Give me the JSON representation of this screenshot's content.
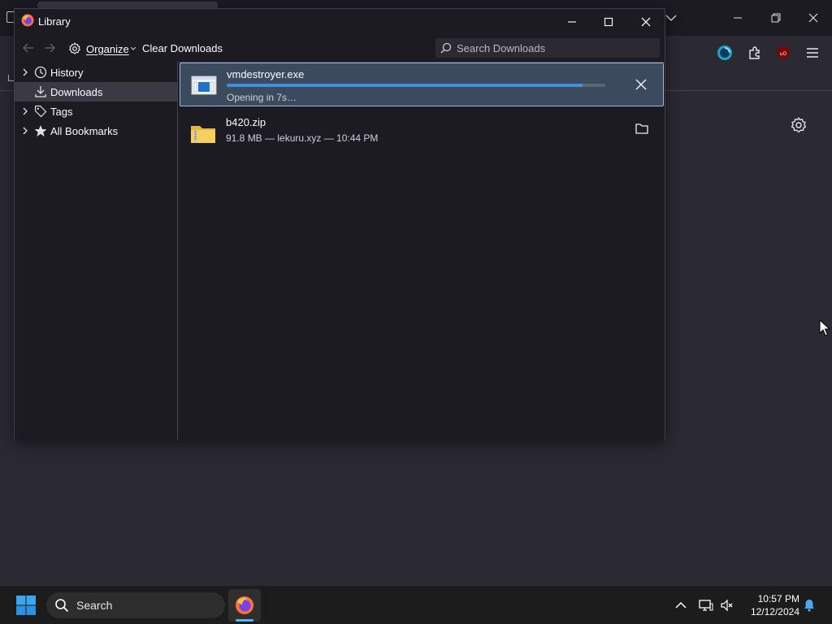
{
  "library_window": {
    "title": "Library",
    "toolbar": {
      "organize_label": "Organize",
      "clear_downloads_label": "Clear Downloads",
      "search_placeholder": "Search Downloads"
    },
    "sidebar": {
      "items": [
        {
          "label": "History",
          "icon": "clock-icon",
          "selected": false
        },
        {
          "label": "Downloads",
          "icon": "download-icon",
          "selected": true
        },
        {
          "label": "Tags",
          "icon": "tag-icon",
          "selected": false
        },
        {
          "label": "All Bookmarks",
          "icon": "star-icon",
          "selected": false
        }
      ]
    },
    "downloads": [
      {
        "name": "vmdestroyer.exe",
        "status": "Opening in 7s…",
        "progress_fraction": 0.94,
        "icon": "executable-icon",
        "action": "cancel"
      },
      {
        "name": "b420.zip",
        "status": "91.8 MB — lekuru.xyz — 10:44 PM",
        "icon": "zip-folder-icon",
        "action": "show-in-folder"
      }
    ]
  },
  "taskbar": {
    "search_label": "Search",
    "time": "10:57 PM",
    "date": "12/12/2024"
  },
  "colors": {
    "accent": "#3d8fe0",
    "active_item_bg": "#3c4a5e",
    "window_bg": "#1c1b22"
  }
}
